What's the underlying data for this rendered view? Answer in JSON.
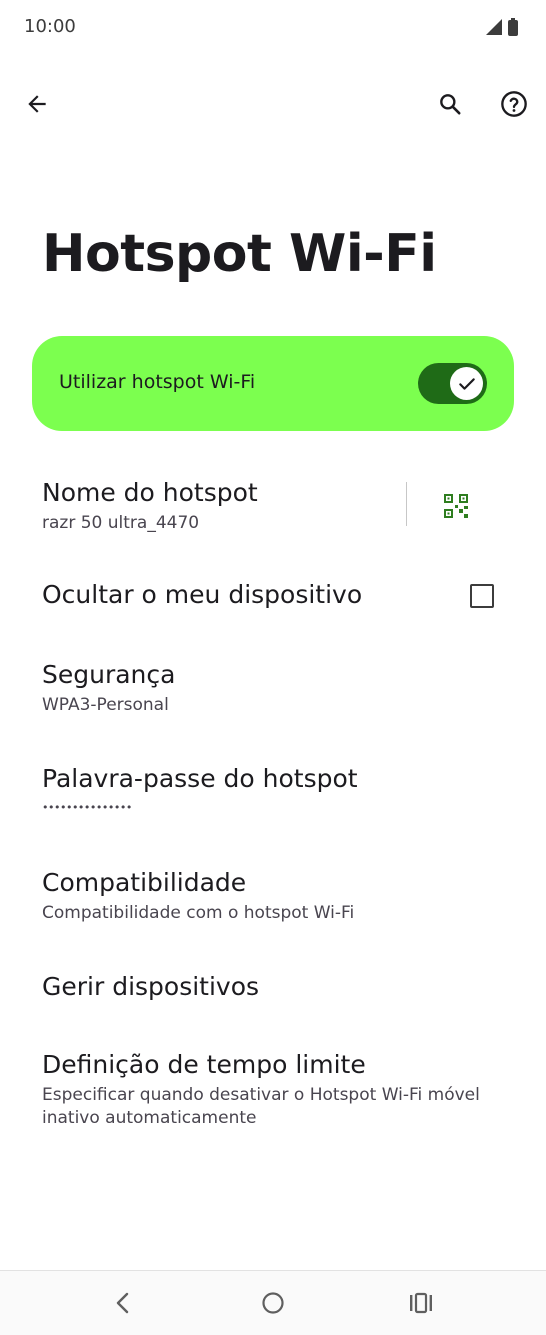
{
  "status_bar": {
    "time": "10:00",
    "icons": [
      "signal-icon",
      "battery-icon"
    ]
  },
  "app_bar": {
    "icons": [
      "back-arrow-icon",
      "search-icon",
      "help-icon"
    ]
  },
  "page": {
    "title": "Hotspot Wi-Fi"
  },
  "main_switch": {
    "label": "Utilizar hotspot Wi-Fi",
    "checked": true,
    "background_color": "#7cff4f",
    "track_color": "#1f6b17"
  },
  "preferences": {
    "hotspot_name": {
      "title": "Nome do hotspot",
      "summary": "razr 50 ultra_4470",
      "action_icon": "qr-code-icon"
    },
    "hide_device": {
      "title": "Ocultar o meu dispositivo",
      "checked": false
    },
    "security": {
      "title": "Segurança",
      "summary": "WPA3-Personal"
    },
    "password": {
      "title": "Palavra-passe do hotspot",
      "summary": "•••••••••••••••"
    },
    "compatibility": {
      "title": "Compatibilidade",
      "summary": "Compatibilidade com o hotspot Wi-Fi"
    },
    "manage_devices": {
      "title": "Gerir dispositivos"
    },
    "timeout": {
      "title": "Definição de tempo limite",
      "summary": "Especificar quando desativar o Hotspot Wi-Fi móvel inativo automaticamente"
    }
  },
  "nav_bar": {
    "icons": [
      "nav-back-icon",
      "nav-home-icon",
      "nav-recents-icon"
    ]
  }
}
